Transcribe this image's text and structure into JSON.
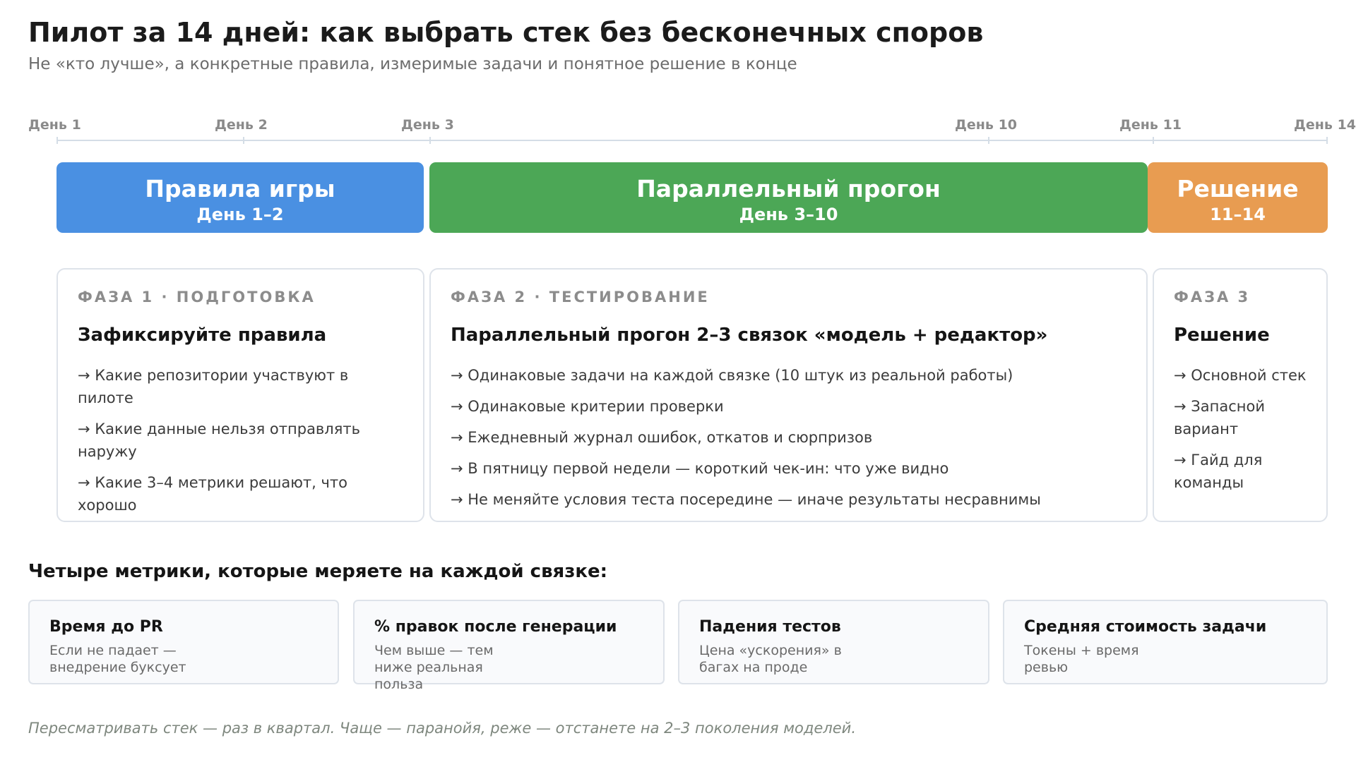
{
  "header": {
    "title": "Пилот за 14 дней: как выбрать стек без бесконечных споров",
    "subtitle": "Не «кто лучше», а конкретные правила, измеримые задачи и понятное решение в конце"
  },
  "timeline": {
    "labels": [
      "День 1",
      "День 2",
      "День 3",
      "День 10",
      "День 11",
      "День 14"
    ]
  },
  "phases_bar": [
    {
      "title": "Правила игры",
      "range": "День 1–2",
      "color": "#4a90e2"
    },
    {
      "title": "Параллельный прогон",
      "range": "День 3–10",
      "color": "#4ca756"
    },
    {
      "title": "Решение",
      "range": "11–14",
      "color": "#e89c51"
    }
  ],
  "cards": [
    {
      "eyebrow": "ФАЗА 1 · ПОДГОТОВКА",
      "heading": "Зафиксируйте правила",
      "items": [
        "→ Какие репозитории участвуют в пилоте",
        "→ Какие данные нельзя отправлять наружу",
        "→ Какие 3–4 метрики решают, что хорошо"
      ]
    },
    {
      "eyebrow": "ФАЗА 2 · ТЕСТИРОВАНИЕ",
      "heading": "Параллельный прогон 2–3 связок «модель + редактор»",
      "items": [
        "→ Одинаковые задачи на каждой связке (10 штук из реальной работы)",
        "→ Одинаковые критерии проверки",
        "→ Ежедневный журнал ошибок, откатов и сюрпризов",
        "→ В пятницу первой недели — короткий чек-ин: что уже видно",
        "→ Не меняйте условия теста посередине — иначе результаты несравнимы"
      ]
    },
    {
      "eyebrow": "ФАЗА 3",
      "heading": "Решение",
      "items": [
        "→ Основной стек",
        "→ Запасной вариант",
        "→ Гайд для команды"
      ]
    }
  ],
  "metrics": {
    "heading": "Четыре метрики, которые меряете на каждой связке:",
    "items": [
      {
        "title": "Время до PR",
        "desc": "Если не падает — внедрение буксует"
      },
      {
        "title": "% правок после генерации",
        "desc": "Чем выше — тем ниже реальная польза"
      },
      {
        "title": "Падения тестов",
        "desc": "Цена «ускорения» в багах на проде"
      },
      {
        "title": "Средняя стоимость задачи",
        "desc": "Токены + время ревью"
      }
    ]
  },
  "footer": {
    "note": "Пересматривать стек — раз в квартал. Чаще — паранойя, реже — отстанете на 2–3 поколения моделей."
  }
}
